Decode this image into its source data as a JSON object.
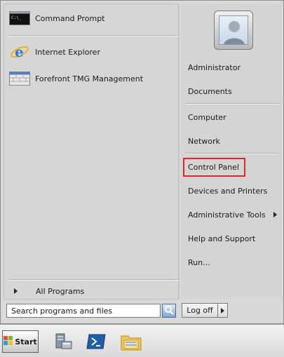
{
  "left_pane": {
    "pinned": [
      {
        "label": "Command Prompt",
        "icon": "command-prompt-icon"
      }
    ],
    "recent": [
      {
        "label": "Internet Explorer",
        "icon": "internet-explorer-icon"
      },
      {
        "label": "Forefront TMG Management",
        "icon": "forefront-tmg-icon"
      }
    ],
    "all_programs_label": "All Programs"
  },
  "right_pane": {
    "user_icon": "user-account-picture",
    "items": [
      {
        "label": "Administrator"
      },
      {
        "label": "Documents"
      },
      {
        "label": "Computer"
      },
      {
        "label": "Network"
      },
      {
        "label": "Control Panel",
        "highlighted": true
      },
      {
        "label": "Devices and Printers"
      },
      {
        "label": "Administrative Tools",
        "has_submenu": true
      },
      {
        "label": "Help and Support"
      },
      {
        "label": "Run..."
      }
    ]
  },
  "bottom": {
    "search_placeholder": "Search programs and files",
    "logoff_label": "Log off"
  },
  "taskbar": {
    "start_label": "Start",
    "pinned_icons": [
      "server-manager-icon",
      "powershell-icon",
      "explorer-folder-icon"
    ]
  },
  "colors": {
    "highlight_box": "#e0242b",
    "menu_bg": "#d9d9d9"
  }
}
